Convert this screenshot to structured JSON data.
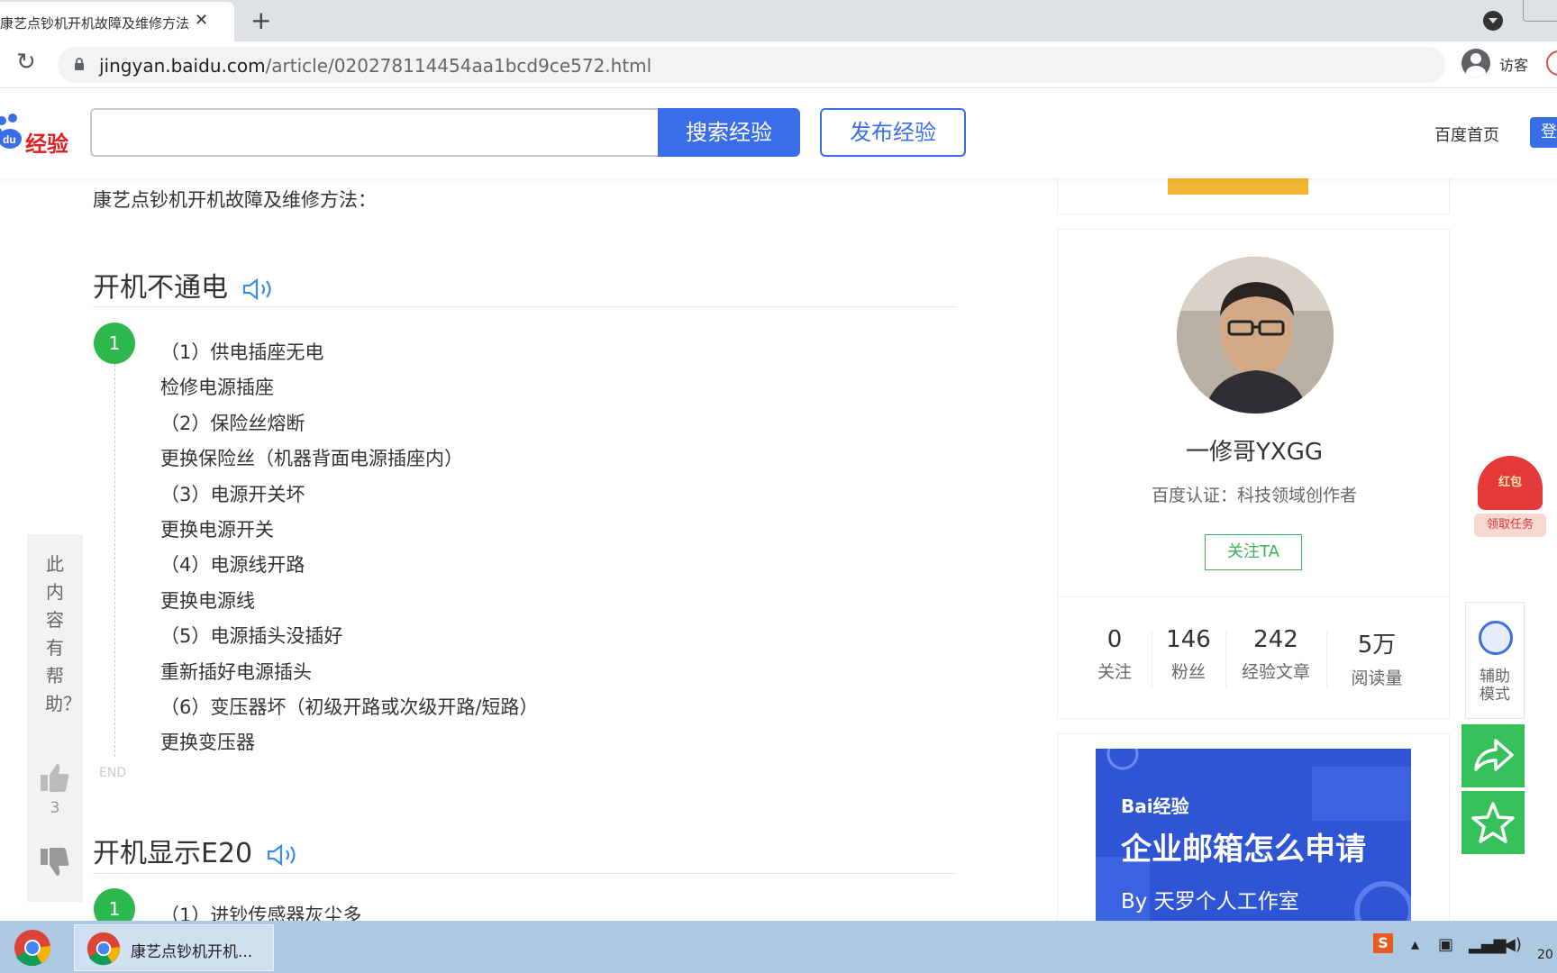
{
  "browser": {
    "tab_title": "康艺点钞机开机故障及维修方法",
    "tab_close": "✕",
    "new_tab": "+",
    "url_host": "jingyan.baidu.com",
    "url_path": "/article/020278114454aa1bcd9ce572.html",
    "guest_label": "访客"
  },
  "header": {
    "logo_text": "经验",
    "search_placeholder": "",
    "search_button": "搜索经验",
    "publish_button": "发布经验",
    "home_link": "百度首页",
    "login_button": "登"
  },
  "article": {
    "intro": "康艺点钞机开机故障及维修方法：",
    "section1_title": "开机不通电",
    "step1_number": "1",
    "step1_lines": [
      "（1）供电插座无电",
      "检修电源插座",
      "（2）保险丝熔断",
      "更换保险丝（机器背面电源插座内）",
      "（3）电源开关坏",
      "更换电源开关",
      "（4）电源线开路",
      "更换电源线",
      "（5）电源插头没插好",
      "重新插好电源插头",
      "（6）变压器坏（初级开路或次级开路/短路）",
      "更换变压器"
    ],
    "end_mark": "END",
    "section2_title": "开机显示E20",
    "step2_number": "1",
    "step2_line": "（1）进钞传感器灰尘多"
  },
  "feedback": {
    "question": "此内容有帮助？",
    "like_count": "3"
  },
  "author": {
    "name": "一修哥YXGG",
    "certification": "百度认证：科技领域创作者",
    "follow_button": "关注TA",
    "stats": [
      {
        "num": "0",
        "label": "关注"
      },
      {
        "num": "146",
        "label": "粉丝"
      },
      {
        "num": "242",
        "label": "经验文章"
      },
      {
        "num": "5万",
        "label": "阅读量"
      }
    ]
  },
  "ad": {
    "brand": "Bai经验",
    "title": "企业邮箱怎么申请",
    "byline": "By 天罗个人工作室"
  },
  "widgets": {
    "redpacket_top": "红包",
    "redpacket_bottom": "领取任务",
    "assist_label": "辅助模式"
  },
  "taskbar": {
    "app_label": "康艺点钞机开机...",
    "clock": "20"
  },
  "colors": {
    "brand_blue": "#3a6ee8",
    "step_green": "#2db84d",
    "follow_green": "#3cb35a",
    "share_green": "#35c05a"
  }
}
